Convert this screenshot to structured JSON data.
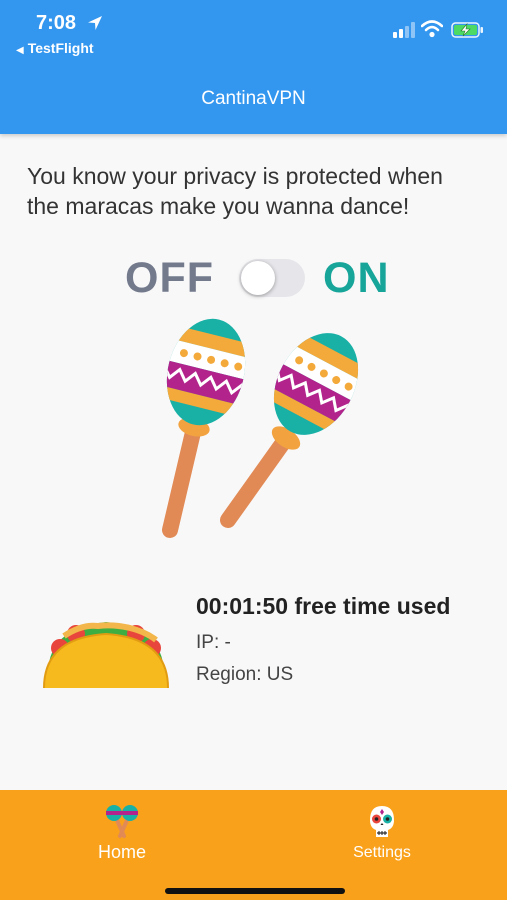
{
  "status_bar": {
    "time": "7:08",
    "back_app": "TestFlight",
    "icons": [
      "location-arrow-icon",
      "cellular-signal-icon",
      "wifi-icon",
      "battery-charging-icon"
    ]
  },
  "header": {
    "title": "CantinaVPN",
    "color": "#3396ef"
  },
  "main": {
    "intro": "You know your privacy is protected when the maracas make you wanna dance!",
    "toggle": {
      "off_label": "OFF",
      "on_label": "ON",
      "state": "off",
      "on_color": "#17a59a",
      "off_color": "#737a8c"
    },
    "hero_icon": "maracas-icon",
    "status": {
      "icon": "taco-icon",
      "timer": "00:01:50 free time used",
      "ip": "IP: -",
      "region": "Region: US"
    }
  },
  "bottom_nav": {
    "color": "#f9a11b",
    "items": [
      {
        "label": "Home",
        "icon": "maracas-icon"
      },
      {
        "label": "Settings",
        "icon": "sugar-skull-icon"
      }
    ]
  }
}
